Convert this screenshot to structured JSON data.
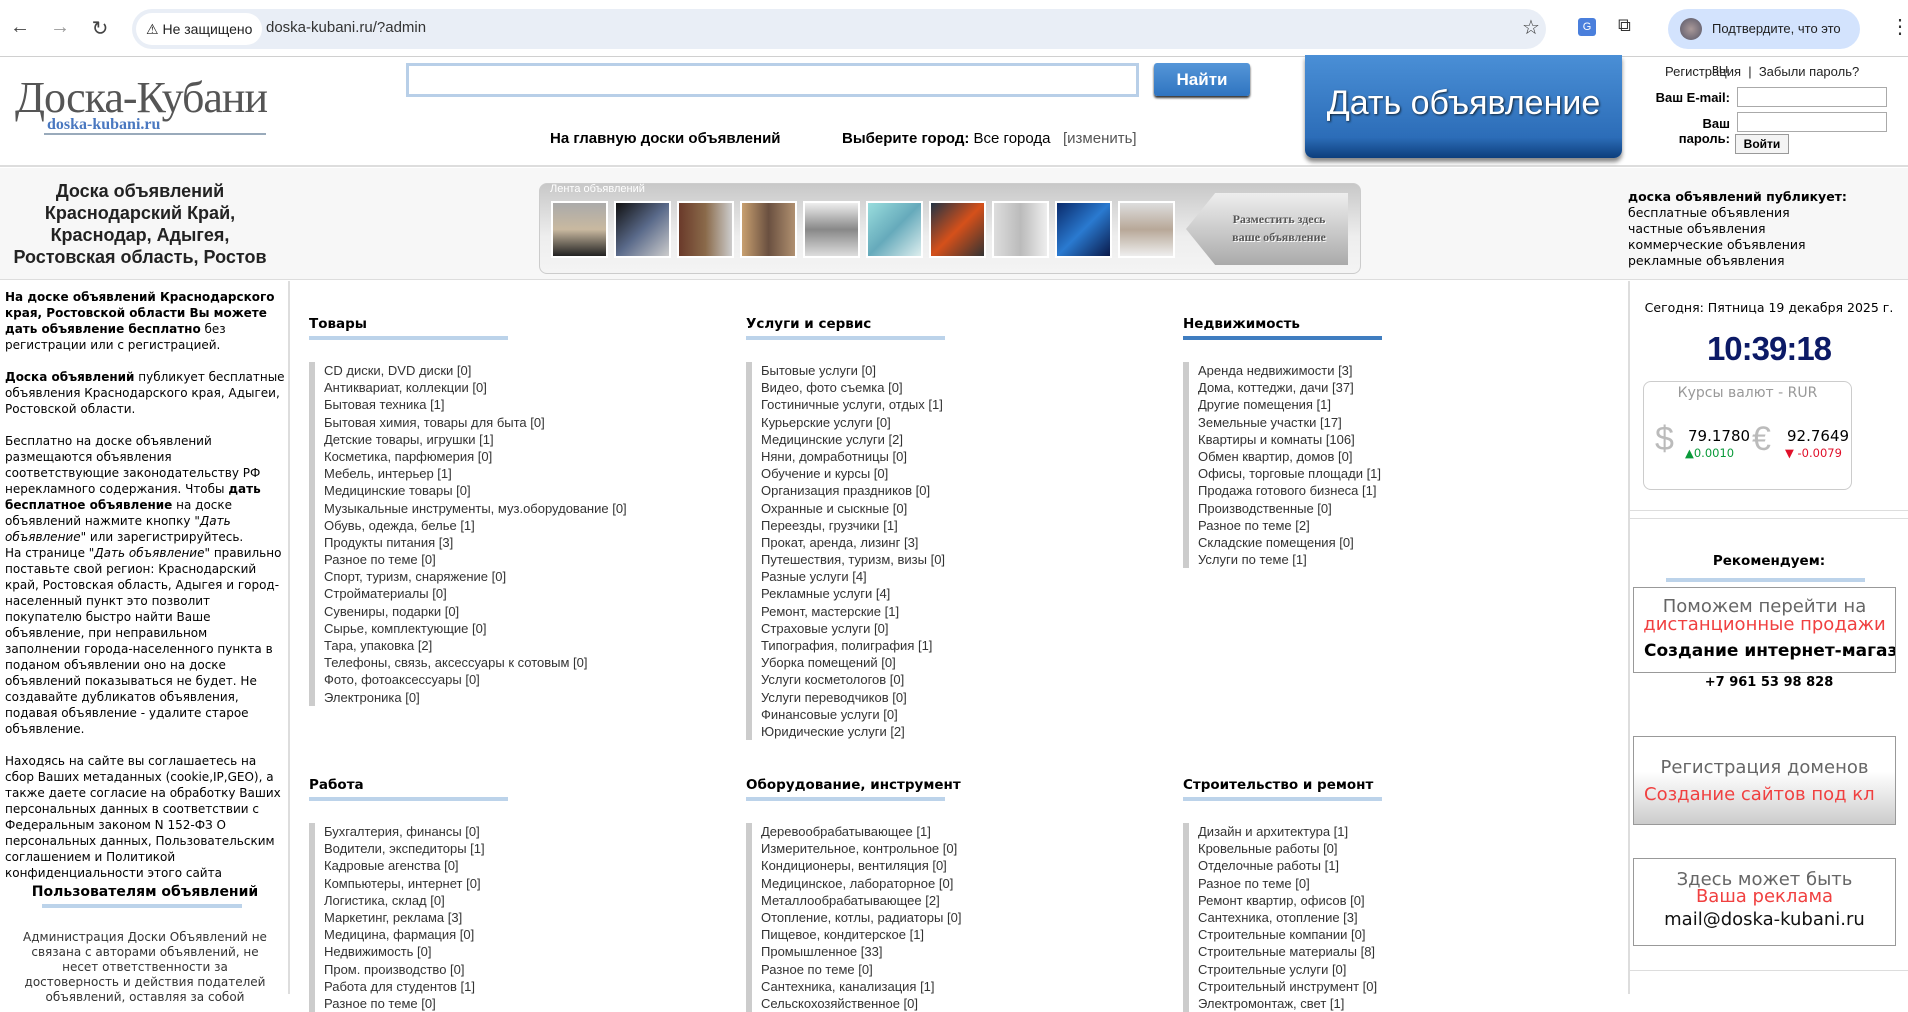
{
  "browser": {
    "back": "←",
    "forward": "→",
    "reload": "↻",
    "security": "Не защищено",
    "url": "doska-kubani.ru/?admin",
    "profile": "Подтвердите, что это вы"
  },
  "header": {
    "logo_title": "Доска-Кубани",
    "logo_sub": "doska-kubani.ru",
    "search_placeholder": "",
    "search_button": "Найти",
    "post_button": "Дать объявление",
    "nav_home": "На главную доски объявлений",
    "city_label": "Выберите город:",
    "city_value": "Все города",
    "city_change": "[изменить]",
    "register": "Регистрация",
    "forgot": "Забыли пароль?",
    "email_label": "Ваш E-mail:",
    "password_label": "Ваш пароль:",
    "login_button": "Войти"
  },
  "banner": {
    "title_lines": [
      "Доска объявлений",
      "Краснодарский Край,",
      "Краснодар, Адыгея,",
      "Ростовская область, Ростов"
    ],
    "ribbon_label": "Лента объявлений",
    "place_ad": [
      "Разместить здесь",
      "ваше объявление"
    ],
    "publishes_title": "доска объявлений публикует:",
    "publishes": [
      "бесплатные объявления",
      "частные объявления",
      "коммерческие объявления",
      "рекламные объявления"
    ]
  },
  "left": {
    "p1_bold": "На доске объявлений Краснодарского края, Ростовской области Вы можете дать объявление бесплатно",
    "p1_rest": " без регистрации или с регистрацией.",
    "p2_bold": "Доска объявлений",
    "p2_rest": " публикует бесплатные объявления Краснодарского края, Адыгеи, Ростовской области.",
    "p3_a": "Бесплатно на доске объявлений размещаются объявления соответствующие законодательству РФ нерекламного содержания. Чтобы ",
    "p3_bold": "дать бесплатное объявление",
    "p3_b": " на доске объявлений нажмите кнопку \"",
    "p3_i": "Дать объявление",
    "p3_c": "\" или зарегистрируйтесь.",
    "p4_a": "На странице \"",
    "p4_i": "Дать объявление",
    "p4_b": "\" правильно поставьте свой регион: Краснодарский край, Ростовская область, Адыгея и город-населенный пункт это позволит покупателю быстро найти Ваше объявление, при неправильном заполнении города-населенного пункта в поданом объявлении оно на доске объявлений показываться не будет. Не создавайте дубликатов объявления, подавая объявление - удалите старое объявление.",
    "p5": "Находясь на сайте вы соглашаетесь на сбор Ваших метаданных (cookie,IP,GEO), а также даете согласие на обработку Ваших персональных данных в соответствии с Федеральным законом N 152-ФЗ О персональных данных, Пользовательским соглашением и Политикой конфиденциальности этого сайта",
    "users_title": "Пользователям объявлений",
    "users_text": "Администрация Доски Объявлений не связана с авторами объявлений, не несет ответственности за достоверность и действия подателей объявлений, оставляя за собой"
  },
  "categories": [
    {
      "title": "Товары",
      "items": [
        "CD диски, DVD диски [0]",
        "Антиквариат, коллекции [0]",
        "Бытовая техника [1]",
        "Бытовая химия, товары для быта [0]",
        "Детские товары, игрушки [1]",
        "Косметика, парфюмерия [0]",
        "Мебель, интерьер [1]",
        "Медицинские товары [0]",
        "Музыкальные инструменты, муз.оборудование [0]",
        "Обувь, одежда, белье [1]",
        "Продукты питания [3]",
        "Разное по теме [0]",
        "Спорт, туризм, снаряжение [0]",
        "Стройматериалы [0]",
        "Сувениры, подарки [0]",
        "Сырье, комплектующие [0]",
        "Тара, упаковка [2]",
        "Телефоны, связь, аксессуары к сотовым [0]",
        "Фото, фотоаксессуары [0]",
        "Электроника [0]"
      ]
    },
    {
      "title": "Услуги и сервис",
      "items": [
        "Бытовые услуги [0]",
        "Видео, фото съемка [0]",
        "Гостиничные услуги, отдых [1]",
        "Курьерские услуги [0]",
        "Медицинские услуги [2]",
        "Няни, домработницы [0]",
        "Обучение и курсы [0]",
        "Организация праздников [0]",
        "Охранные и сыскные [0]",
        "Переезды, грузчики [1]",
        "Прокат, аренда, лизинг [3]",
        "Путешествия, туризм, визы [0]",
        "Разные услуги [4]",
        "Рекламные услуги [4]",
        "Ремонт, мастерские [1]",
        "Страховые услуги [0]",
        "Типография, полиграфия [1]",
        "Уборка помещений [0]",
        "Услуги косметологов [0]",
        "Услуги переводчиков [0]",
        "Финансовые услуги [0]",
        "Юридические услуги [2]"
      ]
    },
    {
      "title": "Недвижимость",
      "active": true,
      "items": [
        "Аренда недвижимости [3]",
        "Дома, коттеджи, дачи [37]",
        "Другие помещения [1]",
        "Земельные участки [17]",
        "Квартиры и комнаты [106]",
        "Обмен квартир, домов [0]",
        "Офисы, торговые площади [1]",
        "Продажа готового бизнеса [1]",
        "Производственные [0]",
        "Разное по теме [2]",
        "Складские помещения [0]",
        "Услуги по теме [1]"
      ]
    },
    {
      "title": "Работа",
      "items": [
        "Бухгалтерия, финансы [0]",
        "Водители, экспедиторы [1]",
        "Кадровые агенства [0]",
        "Компьютеры, интернет [0]",
        "Логистика, склад [0]",
        "Маркетинг, реклама [3]",
        "Медицина, фармация [0]",
        "Недвижимость [0]",
        "Пром. производство [0]",
        "Работа для студентов [1]",
        "Разное по теме [0]"
      ]
    },
    {
      "title": "Оборудование, инструмент",
      "items": [
        "Деревообрабатывающее [1]",
        "Измерительное, контрольное [0]",
        "Кондиционеры, вентиляция [0]",
        "Медицинское, лабораторное [0]",
        "Металлообрабатывающее [2]",
        "Отопление, котлы, радиаторы [0]",
        "Пищевое, кондитерское [1]",
        "Промышленное [33]",
        "Разное по теме [0]",
        "Сантехника, канализация [1]",
        "Сельскохозяйственное [0]"
      ]
    },
    {
      "title": "Строительство и ремонт",
      "items": [
        "Дизайн и архитектура [1]",
        "Кровельные работы [0]",
        "Отделочные работы [1]",
        "Разное по теме [0]",
        "Ремонт квартир, офисов [0]",
        "Сантехника, отопление [3]",
        "Строительные компании [0]",
        "Строительные материалы [8]",
        "Строительные услуги [0]",
        "Строительный инструмент [0]",
        "Электромонтаж, свет [1]"
      ]
    }
  ],
  "right": {
    "today": "Сегодня: Пятница 19 декабря 2025 г.",
    "clock": "10:39:18",
    "fx_title": "Курсы валют - RUR",
    "usd_symbol": "$",
    "usd": "79.1780",
    "usd_change": "▲0.0010",
    "eur_symbol": "€",
    "eur": "92.7649",
    "eur_change": "▼ -0.0079",
    "recommend": "Рекомендуем:",
    "ad1": [
      "Поможем перейти на",
      "дистанционные продажи",
      "Создание интернет-магаз"
    ],
    "phone": "+7 961 53 98 828",
    "ad2": [
      "Регистрация доменов",
      "Создание сайтов под кл"
    ],
    "ad3": [
      "Здесь может быть",
      "Ваша реклама",
      "mail@doska-kubani.ru"
    ]
  },
  "colors": {
    "accent": "#2f74c0",
    "up": "#0a9a3a",
    "down": "#e0102a",
    "ad_red": "#f04040"
  }
}
